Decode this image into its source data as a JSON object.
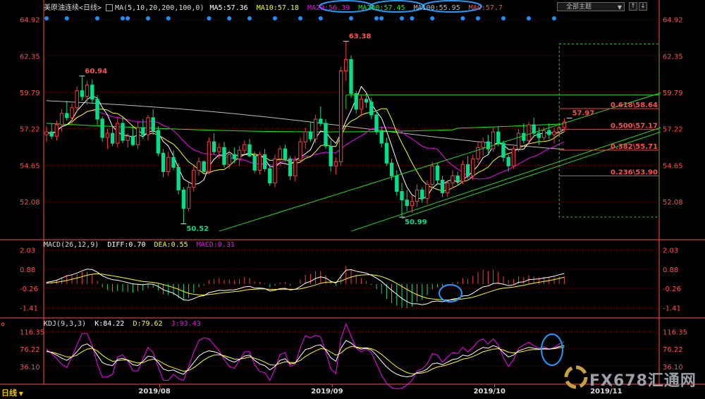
{
  "header": {
    "title": "美原油连续<日线>",
    "ma_spec": "MA(5,10,20,200,100,0)",
    "ma5": "MA5:57.36",
    "ma10": "MA10:57.18",
    "ma20": "MA20:56.39",
    "ma200": "MA200:57.45",
    "ma100": "MA100:55.95",
    "ma0": "MA0:57.7",
    "button_label": "全部主题"
  },
  "macd_header": {
    "spec": "MACD(26,12,9)",
    "diff": "DIFF:0.70",
    "dea": "DEA:0.55",
    "macd": "MACD:0.31"
  },
  "kdj_header": {
    "spec": "KDJ(9,3,3)",
    "k": "K:84.22",
    "d": "D:79.62",
    "j": "J:93.43"
  },
  "timeframe_label": "日线",
  "watermark": "FX678汇通网",
  "colors": {
    "up": "#ff3c3c",
    "down": "#00e08a",
    "ma5": "#ffffff",
    "ma10": "#ffff00",
    "ma20": "#ff00ff",
    "ma200": "#00ff00",
    "ma100": "#bbbbbb",
    "grid": "#8b0000",
    "axis": "#ff4b4b"
  },
  "chart_data": [
    {
      "type": "candlestick",
      "title": "美原油连续<日线>",
      "ylim": [
        49.5,
        65.5
      ],
      "y_ticks": [
        64.92,
        62.35,
        59.79,
        57.22,
        54.65,
        52.08
      ],
      "x_labels": [
        "2019/08",
        "2019/09",
        "2019/10",
        "2019/11"
      ],
      "annotations": [
        {
          "label": "60.94",
          "value": 60.94
        },
        {
          "label": "50.52",
          "value": 50.52
        },
        {
          "label": "63.38",
          "value": 63.38
        },
        {
          "label": "50.99",
          "value": 50.99
        },
        {
          "label": "57.97",
          "value": 57.97
        }
      ],
      "fibonacci": [
        {
          "label": "0.618\\58.64",
          "value": 58.64
        },
        {
          "label": "0.500\\57.17",
          "value": 57.17
        },
        {
          "label": "0.382\\55.71",
          "value": 55.71
        },
        {
          "label": "0.236\\53.90",
          "value": 53.9
        }
      ],
      "horizontal_line": 59.6,
      "projection_box": [
        51.0,
        63.2
      ],
      "candles": [
        [
          56.8,
          57.4,
          56.3,
          57.0
        ],
        [
          57.0,
          57.6,
          56.5,
          56.7
        ],
        [
          56.7,
          57.8,
          56.4,
          57.5
        ],
        [
          57.5,
          58.6,
          57.0,
          58.3
        ],
        [
          58.3,
          59.2,
          57.8,
          58.0
        ],
        [
          58.0,
          59.0,
          57.5,
          58.7
        ],
        [
          58.7,
          60.2,
          58.4,
          59.9
        ],
        [
          59.9,
          60.94,
          59.2,
          59.5
        ],
        [
          59.5,
          60.6,
          58.9,
          60.3
        ],
        [
          60.3,
          60.7,
          59.0,
          59.3
        ],
        [
          59.3,
          59.6,
          57.5,
          57.9
        ],
        [
          57.9,
          58.1,
          56.3,
          56.6
        ],
        [
          56.6,
          57.2,
          55.8,
          56.9
        ],
        [
          56.9,
          57.4,
          56.0,
          56.2
        ],
        [
          56.2,
          58.0,
          55.9,
          57.6
        ],
        [
          57.6,
          58.1,
          56.2,
          56.4
        ],
        [
          56.4,
          56.9,
          55.9,
          56.7
        ],
        [
          56.7,
          57.3,
          56.0,
          56.1
        ],
        [
          56.1,
          57.7,
          55.8,
          57.3
        ],
        [
          57.3,
          57.9,
          56.5,
          56.8
        ],
        [
          56.8,
          58.2,
          56.4,
          58.0
        ],
        [
          58.0,
          58.6,
          56.8,
          57.1
        ],
        [
          57.1,
          57.4,
          55.3,
          55.5
        ],
        [
          55.5,
          55.8,
          53.8,
          54.2
        ],
        [
          54.2,
          55.6,
          53.9,
          55.2
        ],
        [
          55.2,
          55.7,
          54.3,
          54.5
        ],
        [
          54.5,
          54.8,
          52.6,
          52.9
        ],
        [
          52.9,
          53.1,
          50.52,
          51.6
        ],
        [
          51.6,
          53.4,
          51.4,
          53.1
        ],
        [
          53.1,
          54.6,
          52.8,
          54.3
        ],
        [
          54.3,
          55.2,
          53.9,
          54.9
        ],
        [
          54.9,
          55.0,
          54.0,
          54.2
        ],
        [
          54.2,
          56.6,
          54.0,
          56.3
        ],
        [
          56.3,
          56.9,
          55.4,
          55.6
        ],
        [
          55.6,
          56.2,
          55.1,
          55.9
        ],
        [
          55.9,
          56.3,
          54.5,
          54.7
        ],
        [
          54.7,
          55.7,
          54.4,
          55.4
        ],
        [
          55.4,
          55.9,
          54.8,
          55.1
        ],
        [
          55.1,
          56.0,
          54.6,
          55.7
        ],
        [
          55.7,
          56.4,
          55.4,
          56.1
        ],
        [
          56.1,
          56.5,
          55.2,
          55.3
        ],
        [
          55.3,
          55.6,
          54.1,
          54.3
        ],
        [
          54.3,
          55.6,
          54.0,
          55.4
        ],
        [
          55.4,
          55.8,
          54.2,
          54.4
        ],
        [
          54.4,
          54.7,
          53.2,
          53.4
        ],
        [
          53.4,
          55.4,
          53.1,
          55.1
        ],
        [
          55.1,
          56.0,
          54.6,
          55.8
        ],
        [
          55.8,
          56.1,
          54.9,
          55.1
        ],
        [
          55.1,
          55.3,
          53.6,
          53.9
        ],
        [
          53.9,
          55.3,
          53.5,
          55.0
        ],
        [
          55.0,
          56.6,
          54.8,
          56.3
        ],
        [
          56.3,
          57.3,
          55.8,
          57.0
        ],
        [
          57.0,
          57.7,
          56.3,
          56.5
        ],
        [
          56.5,
          58.2,
          56.2,
          57.9
        ],
        [
          57.9,
          58.8,
          57.4,
          57.6
        ],
        [
          57.6,
          57.9,
          55.8,
          56.0
        ],
        [
          56.0,
          56.4,
          54.2,
          54.6
        ],
        [
          54.6,
          55.2,
          54.0,
          54.9
        ],
        [
          54.9,
          61.6,
          54.6,
          61.3
        ],
        [
          61.3,
          63.38,
          60.6,
          62.1
        ],
        [
          62.1,
          62.4,
          59.4,
          59.7
        ],
        [
          59.7,
          59.9,
          58.3,
          58.6
        ],
        [
          58.6,
          59.6,
          58.1,
          59.3
        ],
        [
          59.3,
          59.8,
          58.7,
          59.1
        ],
        [
          59.1,
          59.4,
          57.9,
          58.2
        ],
        [
          58.2,
          58.5,
          56.8,
          57.0
        ],
        [
          57.0,
          57.4,
          55.9,
          56.2
        ],
        [
          56.2,
          56.6,
          54.6,
          54.8
        ],
        [
          54.8,
          55.1,
          53.6,
          53.9
        ],
        [
          53.9,
          54.3,
          52.5,
          52.8
        ],
        [
          52.8,
          53.4,
          50.99,
          52.2
        ],
        [
          52.2,
          52.9,
          51.4,
          51.8
        ],
        [
          51.8,
          52.5,
          51.3,
          52.1
        ],
        [
          52.1,
          53.3,
          51.7,
          52.9
        ],
        [
          52.9,
          53.1,
          52.0,
          52.3
        ],
        [
          52.3,
          53.6,
          51.9,
          53.3
        ],
        [
          53.3,
          54.9,
          53.0,
          54.6
        ],
        [
          54.6,
          54.8,
          53.3,
          53.6
        ],
        [
          53.6,
          53.9,
          52.4,
          52.7
        ],
        [
          52.7,
          53.6,
          52.4,
          53.4
        ],
        [
          53.4,
          54.3,
          53.0,
          53.9
        ],
        [
          53.9,
          54.2,
          53.2,
          53.5
        ],
        [
          53.5,
          55.0,
          53.3,
          54.7
        ],
        [
          54.7,
          55.3,
          53.7,
          53.9
        ],
        [
          53.9,
          55.4,
          53.6,
          55.1
        ],
        [
          55.1,
          56.3,
          54.8,
          55.9
        ],
        [
          55.9,
          56.6,
          55.3,
          56.3
        ],
        [
          56.3,
          56.8,
          55.5,
          55.8
        ],
        [
          55.8,
          57.3,
          55.6,
          57.0
        ],
        [
          57.0,
          57.4,
          56.0,
          56.2
        ],
        [
          56.2,
          56.4,
          54.9,
          55.2
        ],
        [
          55.2,
          55.4,
          54.2,
          54.6
        ],
        [
          54.6,
          56.0,
          54.4,
          55.8
        ],
        [
          55.8,
          57.2,
          55.6,
          56.9
        ],
        [
          56.9,
          57.6,
          56.2,
          56.4
        ],
        [
          56.4,
          57.7,
          56.1,
          57.5
        ],
        [
          57.5,
          58.0,
          56.6,
          56.9
        ],
        [
          56.9,
          57.3,
          56.1,
          56.6
        ],
        [
          56.6,
          57.3,
          56.4,
          57.1
        ],
        [
          57.1,
          57.6,
          56.5,
          56.8
        ],
        [
          56.8,
          57.3,
          56.2,
          57.0
        ],
        [
          57.0,
          57.5,
          56.7,
          57.3
        ],
        [
          57.3,
          57.97,
          57.0,
          57.7
        ]
      ]
    },
    {
      "type": "macd",
      "title": "MACD(26,12,9)",
      "ylim": [
        -1.9,
        2.3
      ],
      "y_ticks": [
        2.03,
        0.88,
        -0.26,
        -1.41
      ],
      "diff": [
        0.1,
        0.15,
        0.22,
        0.35,
        0.48,
        0.55,
        0.65,
        0.78,
        0.88,
        0.86,
        0.7,
        0.48,
        0.35,
        0.25,
        0.22,
        0.15,
        0.08,
        0.0,
        -0.02,
        -0.05,
        0.0,
        -0.02,
        -0.15,
        -0.35,
        -0.45,
        -0.55,
        -0.75,
        -0.95,
        -0.98,
        -0.88,
        -0.75,
        -0.7,
        -0.52,
        -0.45,
        -0.38,
        -0.4,
        -0.36,
        -0.35,
        -0.28,
        -0.18,
        -0.15,
        -0.25,
        -0.24,
        -0.28,
        -0.42,
        -0.38,
        -0.28,
        -0.26,
        -0.36,
        -0.32,
        -0.16,
        0.05,
        0.15,
        0.32,
        0.42,
        0.36,
        0.16,
        0.05,
        0.45,
        0.82,
        0.85,
        0.76,
        0.7,
        0.64,
        0.52,
        0.35,
        0.15,
        -0.12,
        -0.38,
        -0.62,
        -0.86,
        -1.05,
        -1.18,
        -1.18,
        -1.24,
        -1.18,
        -1.05,
        -1.02,
        -1.06,
        -1.0,
        -0.9,
        -0.86,
        -0.72,
        -0.7,
        -0.55,
        -0.35,
        -0.18,
        -0.12,
        0.02,
        0.05,
        -0.02,
        -0.1,
        -0.05,
        0.1,
        0.12,
        0.25,
        0.28,
        0.3,
        0.36,
        0.4,
        0.46,
        0.55,
        0.62
      ],
      "dea": [
        0.05,
        0.07,
        0.1,
        0.15,
        0.21,
        0.28,
        0.35,
        0.43,
        0.52,
        0.58,
        0.61,
        0.58,
        0.53,
        0.48,
        0.43,
        0.38,
        0.32,
        0.26,
        0.2,
        0.15,
        0.12,
        0.09,
        0.04,
        -0.04,
        -0.12,
        -0.21,
        -0.32,
        -0.45,
        -0.56,
        -0.62,
        -0.65,
        -0.66,
        -0.63,
        -0.6,
        -0.55,
        -0.52,
        -0.49,
        -0.46,
        -0.43,
        -0.38,
        -0.33,
        -0.32,
        -0.3,
        -0.3,
        -0.32,
        -0.33,
        -0.32,
        -0.31,
        -0.32,
        -0.32,
        -0.29,
        -0.22,
        -0.15,
        -0.06,
        0.04,
        0.1,
        0.11,
        0.1,
        0.17,
        0.3,
        0.41,
        0.48,
        0.53,
        0.55,
        0.55,
        0.51,
        0.44,
        0.33,
        0.19,
        0.03,
        -0.15,
        -0.33,
        -0.5,
        -0.64,
        -0.76,
        -0.85,
        -0.89,
        -0.92,
        -0.95,
        -0.96,
        -0.95,
        -0.93,
        -0.89,
        -0.85,
        -0.79,
        -0.7,
        -0.6,
        -0.5,
        -0.4,
        -0.31,
        -0.25,
        -0.22,
        -0.19,
        -0.13,
        -0.08,
        -0.01,
        0.05,
        0.1,
        0.15,
        0.2,
        0.26,
        0.33,
        0.4
      ],
      "macd": [
        0.1,
        0.16,
        0.24,
        0.4,
        0.54,
        0.54,
        0.6,
        0.7,
        0.72,
        0.56,
        0.18,
        -0.2,
        -0.36,
        -0.46,
        -0.42,
        -0.46,
        -0.48,
        -0.52,
        -0.44,
        -0.4,
        -0.24,
        -0.22,
        -0.38,
        -0.62,
        -0.66,
        -0.68,
        -0.86,
        -1.0,
        -0.84,
        -0.52,
        -0.2,
        -0.08,
        0.22,
        0.3,
        0.34,
        0.24,
        0.26,
        0.22,
        0.3,
        0.4,
        0.36,
        0.14,
        0.12,
        0.04,
        -0.2,
        -0.1,
        0.08,
        0.1,
        -0.08,
        0.0,
        0.26,
        0.54,
        0.6,
        0.76,
        0.76,
        0.52,
        0.1,
        -0.1,
        0.56,
        1.04,
        0.88,
        0.56,
        0.34,
        0.18,
        -0.06,
        -0.32,
        -0.58,
        -0.9,
        -1.14,
        -1.3,
        -1.42,
        -1.44,
        -1.36,
        -1.08,
        -0.96,
        -0.66,
        -0.32,
        -0.2,
        -0.22,
        -0.08,
        0.1,
        0.14,
        0.34,
        0.3,
        0.48,
        0.7,
        0.84,
        0.76,
        0.84,
        0.72,
        0.46,
        0.24,
        0.28,
        0.46,
        0.4,
        0.52,
        0.46,
        0.4,
        0.42,
        0.4,
        0.4,
        0.44,
        0.44
      ]
    },
    {
      "type": "kdj",
      "title": "KDJ(9,3,3)",
      "ylim": [
        0,
        130
      ],
      "y_ticks": [
        116.35,
        76.22,
        36.1
      ],
      "k": [
        72,
        68,
        62,
        55,
        50,
        58,
        70,
        84,
        88,
        80,
        62,
        45,
        40,
        38,
        52,
        55,
        50,
        40,
        38,
        48,
        60,
        58,
        45,
        30,
        26,
        28,
        22,
        18,
        30,
        45,
        60,
        68,
        72,
        70,
        66,
        58,
        50,
        46,
        52,
        60,
        62,
        50,
        42,
        38,
        28,
        36,
        50,
        54,
        42,
        44,
        60,
        75,
        78,
        84,
        86,
        74,
        56,
        48,
        78,
        96,
        90,
        80,
        76,
        78,
        74,
        62,
        48,
        35,
        25,
        18,
        14,
        12,
        14,
        22,
        24,
        30,
        42,
        44,
        40,
        46,
        52,
        54,
        62,
        60,
        66,
        74,
        80,
        78,
        84,
        80,
        68,
        58,
        62,
        72,
        76,
        80,
        78,
        76,
        78,
        76,
        78,
        82,
        84
      ],
      "d": [
        70,
        69,
        66,
        62,
        58,
        58,
        62,
        70,
        76,
        78,
        72,
        62,
        54,
        48,
        49,
        51,
        51,
        47,
        44,
        45,
        50,
        53,
        50,
        43,
        37,
        33,
        29,
        25,
        27,
        33,
        42,
        51,
        58,
        62,
        63,
        61,
        57,
        53,
        53,
        55,
        58,
        55,
        51,
        46,
        40,
        39,
        43,
        47,
        45,
        45,
        50,
        59,
        66,
        72,
        77,
        76,
        69,
        62,
        67,
        77,
        82,
        81,
        79,
        79,
        77,
        72,
        64,
        54,
        44,
        35,
        28,
        22,
        19,
        20,
        21,
        24,
        30,
        35,
        37,
        40,
        44,
        48,
        53,
        55,
        59,
        64,
        70,
        73,
        76,
        77,
        74,
        69,
        67,
        69,
        71,
        74,
        75,
        75,
        76,
        76,
        77,
        79,
        80
      ],
      "j": [
        76,
        66,
        54,
        41,
        34,
        58,
        86,
        112,
        112,
        84,
        42,
        11,
        12,
        18,
        58,
        63,
        48,
        26,
        26,
        54,
        80,
        68,
        35,
        4,
        4,
        18,
        8,
        4,
        36,
        69,
        96,
        102,
        100,
        86,
        72,
        52,
        36,
        32,
        50,
        70,
        70,
        40,
        24,
        22,
        4,
        30,
        64,
        68,
        36,
        42,
        80,
        107,
        102,
        108,
        104,
        70,
        30,
        20,
        100,
        134,
        106,
        78,
        70,
        76,
        68,
        42,
        16,
        -3,
        -13,
        -16,
        -14,
        -7,
        4,
        26,
        30,
        42,
        66,
        62,
        46,
        58,
        68,
        66,
        80,
        70,
        80,
        94,
        100,
        88,
        100,
        86,
        56,
        36,
        52,
        78,
        86,
        92,
        84,
        78,
        82,
        76,
        80,
        88,
        93
      ]
    }
  ]
}
